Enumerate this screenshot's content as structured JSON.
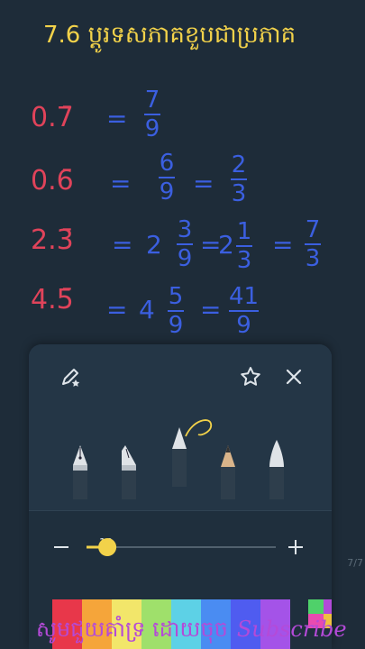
{
  "board": {
    "title": "7.6 ប្តូរទសភាគខួបជាប្រភាគ",
    "rows": [
      {
        "decimal": "0.7̄",
        "eq": "=",
        "num": "7",
        "den": "9"
      },
      {
        "decimal": "0.6̄",
        "eq": "=",
        "num": "6",
        "den": "9",
        "eq2": "=",
        "num2": "2",
        "den2": "3"
      },
      {
        "decimal": "2.3̄",
        "eq": "=",
        "whole": "2",
        "num": "3",
        "den": "9",
        "eq2": "=",
        "whole2": "2",
        "num2": "1",
        "den2": "3",
        "eq3": "=",
        "num3": "7",
        "den3": "3"
      },
      {
        "decimal": "4.5̄",
        "eq": "=",
        "whole": "4",
        "num": "5",
        "den": "9",
        "eq2": "=",
        "num2": "41",
        "den2": "9"
      }
    ],
    "page_indicator": "7/7"
  },
  "pen_panel": {
    "size_value": "10",
    "minus": "−",
    "plus": "+",
    "size_fraction": 0.11,
    "pens": [
      "fountain-pen",
      "calligraphy-pen",
      "ballpoint-pen",
      "pencil",
      "brush-pen"
    ],
    "selected_pen": "ballpoint-pen",
    "colors": [
      "#e8374a",
      "#f5a53a",
      "#f2e66a",
      "#9fe06b",
      "#5dd1e6",
      "#4a8cf2",
      "#4f5cf0",
      "#a453e8"
    ],
    "custom_colors": [
      "#4fd16a",
      "#b24ad8",
      "#e84bb0",
      "#f0c040"
    ]
  },
  "caption": {
    "khmer": "សូមជួយគាំទ្រ ដោយចុច",
    "latin": "Subscribe"
  }
}
